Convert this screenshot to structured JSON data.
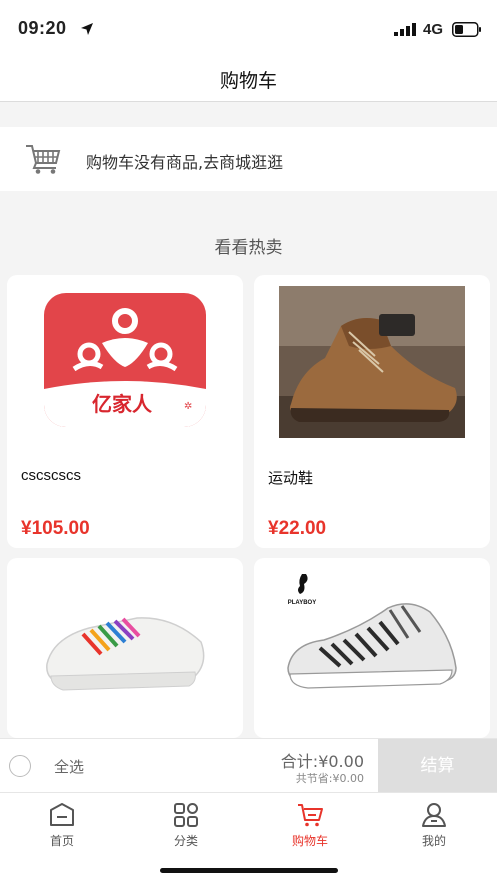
{
  "status": {
    "time": "09:20",
    "network": "4G"
  },
  "nav": {
    "title": "购物车"
  },
  "empty": {
    "message": "购物车没有商品,去商城逛逛",
    "icon": "cart-icon"
  },
  "hot": {
    "title": "看看热卖"
  },
  "products": [
    {
      "name": "cscscscs",
      "price": "¥105.00",
      "logo_text": "亿家人"
    },
    {
      "name": "运动鞋",
      "price": "¥22.00"
    },
    {
      "name": "",
      "price": ""
    },
    {
      "name": "",
      "price": "",
      "brand_text": "PLAYBOY"
    }
  ],
  "checkout": {
    "select_all": "全选",
    "total": "合计:¥0.00",
    "saved": "共节省:¥0.00",
    "button": "结算"
  },
  "tabs": [
    {
      "label": "首页",
      "icon": "home-icon"
    },
    {
      "label": "分类",
      "icon": "category-grid-icon"
    },
    {
      "label": "购物车",
      "icon": "cart-icon",
      "active": true
    },
    {
      "label": "我的",
      "icon": "profile-icon"
    }
  ],
  "colors": {
    "accent": "#e8342b",
    "logo_red": "#e2454a",
    "disabled_button": "#dedede"
  }
}
